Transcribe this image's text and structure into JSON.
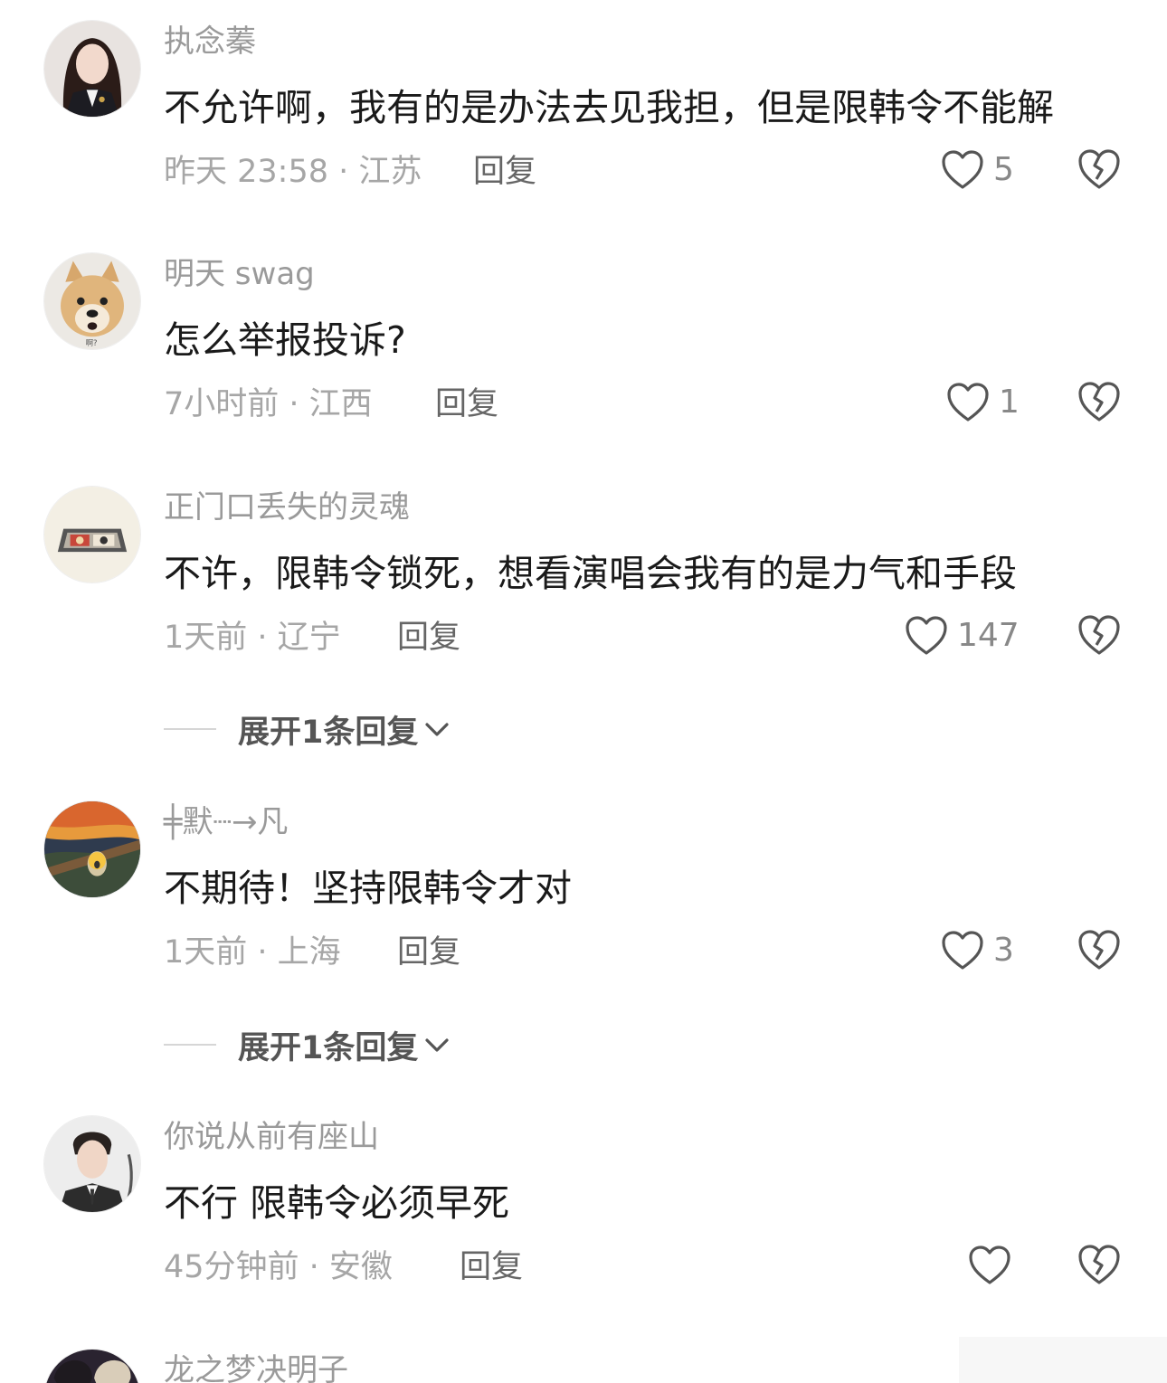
{
  "comments": [
    {
      "username": "执念蓁",
      "text": "不允许啊，我有的是办法去见我担，但是限韩令不能解",
      "meta": "昨天 23:58 · 江苏",
      "reply_label": "回复",
      "likes": "5",
      "avatar_icon": "girl-portrait-avatar"
    },
    {
      "username": "明天 swag",
      "text": "怎么举报投诉?",
      "meta": "7小时前 · 江西",
      "reply_label": "回复",
      "likes": "1",
      "avatar_icon": "shiba-dog-avatar"
    },
    {
      "username": "正门口丢失的灵魂",
      "text": "不许，限韩令锁死，想看演唱会我有的是力气和手段",
      "meta": "1天前 · 辽宁",
      "reply_label": "回复",
      "likes": "147",
      "avatar_icon": "cartoon-tray-avatar",
      "expand_label": "展开1条回复"
    },
    {
      "username": "╪默┈→凡",
      "text": "不期待！坚持限韩令才对",
      "meta": "1天前 · 上海",
      "reply_label": "回复",
      "likes": "3",
      "avatar_icon": "scream-painting-avatar",
      "expand_label": "展开1条回复"
    },
    {
      "username": "你说从前有座山",
      "text": "不行 限韩令必须早死",
      "meta": "45分钟前 · 安徽",
      "reply_label": "回复",
      "likes": "",
      "avatar_icon": "man-portrait-avatar"
    },
    {
      "username": "龙之梦决明子",
      "avatar_icon": "group-photo-avatar"
    }
  ],
  "colors": {
    "username": "#9a9a9a",
    "content": "#1a1a1a",
    "meta": "#a6a6a6",
    "icon": "#555555"
  }
}
